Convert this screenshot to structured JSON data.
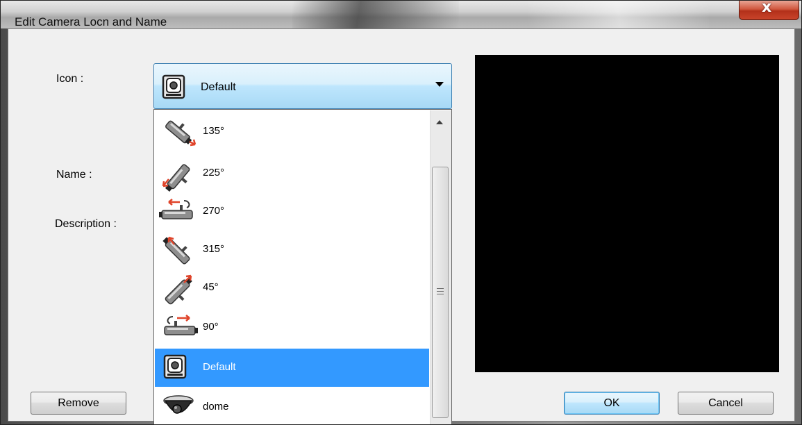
{
  "window": {
    "title": "Edit Camera Locn and Name",
    "close_glyph": "x"
  },
  "form": {
    "icon_label": "Icon :",
    "name_label": "Name :",
    "description_label": "Description :"
  },
  "icon_combo": {
    "selected_value": "Default",
    "selected_icon": "camera-ptz-icon",
    "options": [
      {
        "label": "135°",
        "icon": "camera-135-icon"
      },
      {
        "label": "225°",
        "icon": "camera-225-icon"
      },
      {
        "label": "270°",
        "icon": "camera-270-icon"
      },
      {
        "label": "315°",
        "icon": "camera-315-icon"
      },
      {
        "label": "45°",
        "icon": "camera-45-icon"
      },
      {
        "label": "90°",
        "icon": "camera-90-icon"
      },
      {
        "label": "Default",
        "icon": "camera-ptz-icon",
        "selected": true
      },
      {
        "label": "dome",
        "icon": "dome-camera-icon"
      }
    ]
  },
  "buttons": {
    "remove": "Remove",
    "ok": "OK",
    "cancel": "Cancel"
  },
  "colors": {
    "selection": "#3399ff",
    "preview_background": "#000000",
    "close_button": "#c9442a"
  }
}
